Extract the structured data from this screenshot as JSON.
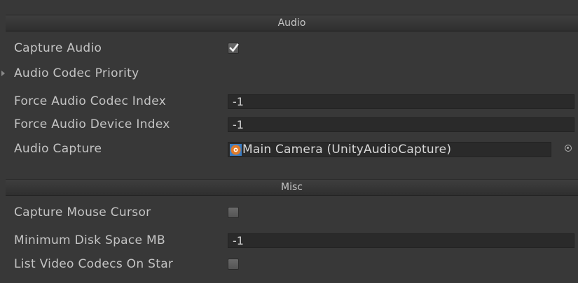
{
  "sections": {
    "audio": {
      "title": "Audio",
      "capture_audio": {
        "label": "Capture Audio",
        "checked": true
      },
      "audio_codec_priority": {
        "label": "Audio Codec Priority"
      },
      "force_audio_codec_index": {
        "label": "Force Audio Codec Index",
        "value": "-1"
      },
      "force_audio_device_index": {
        "label": "Force Audio Device Index",
        "value": "-1"
      },
      "audio_capture": {
        "label": "Audio Capture",
        "value": "Main Camera (UnityAudioCapture)",
        "icon": "gameobject-audio-icon"
      }
    },
    "misc": {
      "title": "Misc",
      "capture_mouse_cursor": {
        "label": "Capture Mouse Cursor",
        "checked": false
      },
      "minimum_disk_space": {
        "label": "Minimum Disk Space MB",
        "value": "-1"
      },
      "list_video_codecs": {
        "label": "List Video Codecs On Star",
        "checked": false
      }
    }
  },
  "colors": {
    "background": "#383838",
    "field": "#2a2a2a",
    "text": "#c4c4c4",
    "icon_orange": "#e07b2a"
  }
}
